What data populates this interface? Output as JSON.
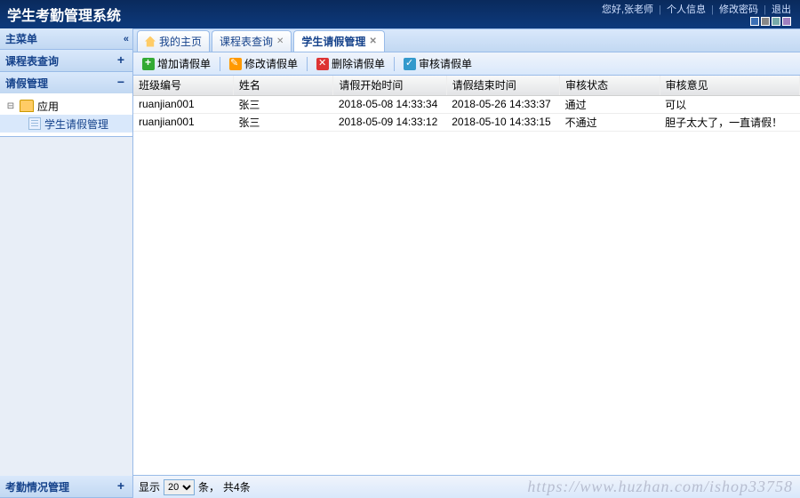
{
  "header": {
    "title": "学生考勤管理系统",
    "greeting": "您好,张老师",
    "links": {
      "profile": "个人信息",
      "password": "修改密码",
      "logout": "退出"
    }
  },
  "sidebar": {
    "title": "主菜单",
    "sections": [
      {
        "title": "课程表查询",
        "expanded": false
      },
      {
        "title": "请假管理",
        "expanded": true,
        "tree": {
          "root": "应用",
          "children": [
            "学生请假管理"
          ]
        }
      },
      {
        "title": "考勤情况管理",
        "expanded": false
      }
    ]
  },
  "tabs": [
    {
      "label": "我的主页",
      "closable": false,
      "icon": "home"
    },
    {
      "label": "课程表查询",
      "closable": true
    },
    {
      "label": "学生请假管理",
      "closable": true,
      "active": true
    }
  ],
  "toolbar": {
    "add": "增加请假单",
    "edit": "修改请假单",
    "delete": "删除请假单",
    "review": "审核请假单"
  },
  "grid": {
    "columns": [
      "班级编号",
      "姓名",
      "请假开始时间",
      "请假结束时间",
      "审核状态",
      "审核意见"
    ],
    "rows": [
      {
        "class_id": "ruanjian001",
        "name": "张三",
        "start": "2018-05-08 14:33:34",
        "end": "2018-05-26 14:33:37",
        "status": "通过",
        "comment": "可以"
      },
      {
        "class_id": "ruanjian001",
        "name": "张三",
        "start": "2018-05-09 14:33:12",
        "end": "2018-05-10 14:33:15",
        "status": "不通过",
        "comment": "胆子太大了，一直请假！"
      }
    ]
  },
  "pager": {
    "show_label": "显示",
    "page_size": "20",
    "unit": "条，",
    "total": "共4条"
  },
  "watermark": "https://www.huzhan.com/ishop33758"
}
